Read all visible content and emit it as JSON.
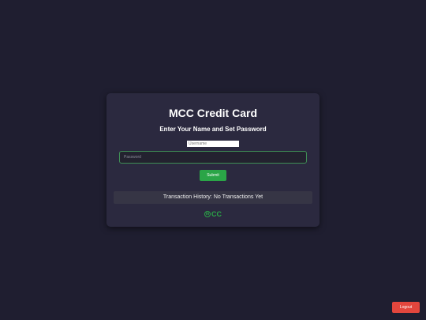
{
  "card": {
    "title": "MCC Credit Card",
    "subtitle": "Enter Your Name and Set Password",
    "username": {
      "placeholder": "Username",
      "value": ""
    },
    "password": {
      "placeholder": "Password",
      "value": ""
    },
    "submit_label": "Submit",
    "history_text": "Transaction History: No Transactions Yet",
    "logo": {
      "mark": "m",
      "text": "CC"
    }
  },
  "logout_label": "Logout",
  "colors": {
    "background": "#1f1e30",
    "card": "#2b293f",
    "accent_green": "#2aa547",
    "logout_red": "#e3463d"
  }
}
